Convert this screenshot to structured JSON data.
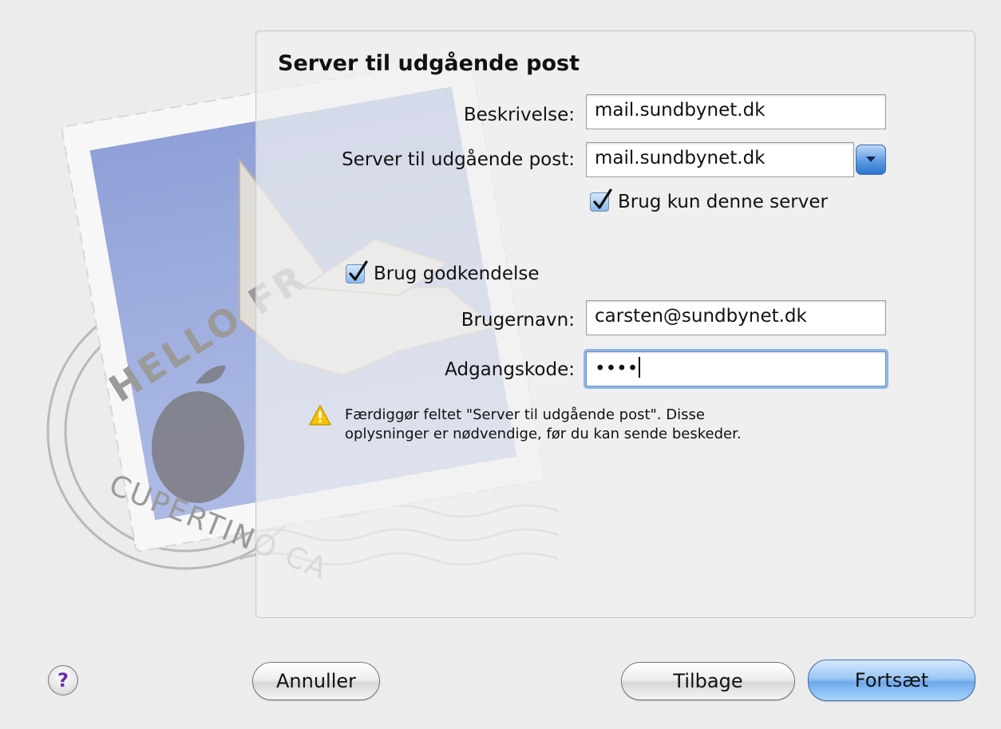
{
  "dialog": {
    "heading": "Server til udgående post"
  },
  "form": {
    "description_label": "Beskrivelse:",
    "description_value": "mail.sundbynet.dk",
    "server_label": "Server til udgående post:",
    "server_value": "mail.sundbynet.dk",
    "only_this_server_label": "Brug kun denne server",
    "only_this_server_checked": true,
    "use_auth_label": "Brug godkendelse",
    "use_auth_checked": true,
    "username_label": "Brugernavn:",
    "username_value": "carsten@sundbynet.dk",
    "password_label": "Adgangskode:",
    "password_value": "••••"
  },
  "warning": {
    "line1": "Færdiggør feltet \"Server til udgående post\". Disse",
    "line2": "oplysninger er nødvendige, før du kan sende beskeder."
  },
  "stamp": {
    "text_top": "HELLO FR",
    "text_bottom": "CUPERTINO CA"
  },
  "buttons": {
    "help": "?",
    "cancel": "Annuller",
    "back": "Tilbage",
    "continue": "Fortsæt"
  },
  "colors": {
    "accent": "#6ea9ec",
    "focus_ring": "#8fb4e3",
    "warning": "#f5c400"
  }
}
